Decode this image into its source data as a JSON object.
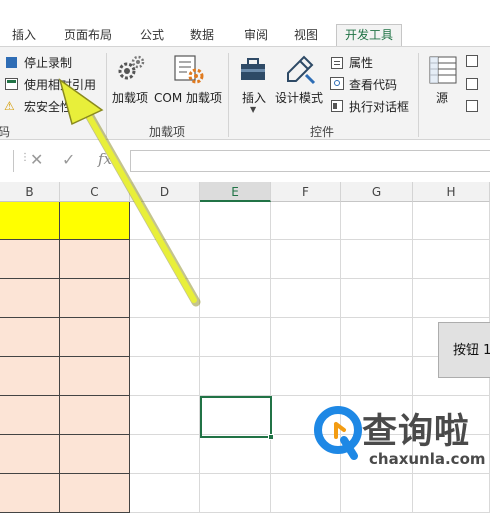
{
  "ribbon_tabs": [
    "插入",
    "页面布局",
    "公式",
    "数据",
    "审阅",
    "视图",
    "开发工具"
  ],
  "active_tab": "开发工具",
  "code_group": {
    "stop_recording": "停止录制",
    "use_relative": "使用相对引用",
    "macro_security": "宏安全性",
    "label_partial": "码"
  },
  "addins_group": {
    "addins": "加载项",
    "com_addins": "COM 加载项",
    "label": "加载项"
  },
  "controls_group": {
    "insert": "插入",
    "design_mode": "设计模式",
    "properties": "属性",
    "view_code": "查看代码",
    "run_dialog": "执行对话框",
    "label": "控件"
  },
  "xml_group": {
    "source": "源"
  },
  "formula_bar": {
    "fx": "fx",
    "cancel": "✕",
    "enter": "✓"
  },
  "columns": [
    "B",
    "C",
    "D",
    "E",
    "F",
    "G",
    "H"
  ],
  "selected_column": "E",
  "form_button_label": "按钮 1",
  "watermark": {
    "name": "查询啦",
    "url": "chaxunla.com"
  },
  "colors": {
    "accent": "#217346",
    "header_yellow": "#ffff00",
    "fill_peach": "#fce4d6",
    "arrow_yellow": "#e8ef3a"
  }
}
